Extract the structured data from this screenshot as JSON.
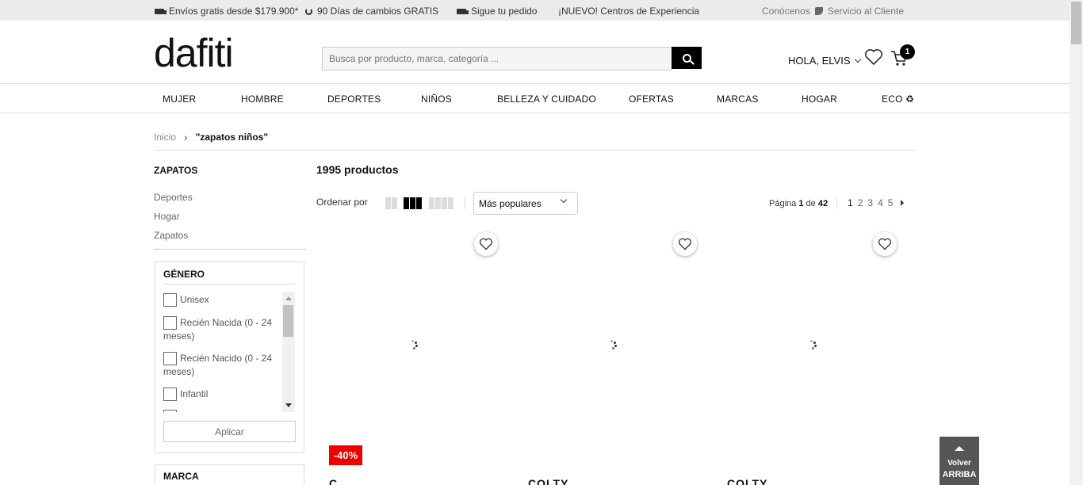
{
  "topbar": {
    "promos": [
      {
        "icon": "truck-icon",
        "text": "Envíos gratis desde $179.900*"
      },
      {
        "icon": "exchange-icon",
        "text": "90 Días de cambios GRATIS"
      },
      {
        "icon": "truck-icon",
        "text": "Sigue tu pedido"
      },
      {
        "icon": "",
        "text": "¡NUEVO! Centros de Experiencia"
      }
    ],
    "about": "Conócenos",
    "service": "Servicio al Cliente"
  },
  "header": {
    "logo": "dafiti",
    "search_placeholder": "Busca por producto, marca, categoría ...",
    "greeting": "HOLA, ELVIS",
    "cart_count": "1"
  },
  "nav": [
    "MUJER",
    "HOMBRE",
    "DEPORTES",
    "NIÑOS",
    "BELLEZA Y CUIDADO",
    "OFERTAS",
    "MARCAS",
    "HOGAR",
    "ECO ♻"
  ],
  "breadcrumb": {
    "home": "Inicio",
    "sep": "›",
    "current": "\"zapatos niños\""
  },
  "sidebar": {
    "category_title": "ZAPATOS",
    "links": [
      "Deportes",
      "Hogar",
      "Zapatos"
    ],
    "gender": {
      "title": "GÉNERO",
      "options": [
        "Unisex",
        "Recién Nacida (0 - 24 meses)",
        "Recién Nacido (0 - 24 meses)",
        "Infantil"
      ],
      "apply": "Aplicar"
    },
    "brand_title": "MARCA"
  },
  "results": {
    "count": "1995 productos",
    "order_label": "Ordenar por",
    "sort_value": "Más populares",
    "page_label": "Página",
    "page_current": "1",
    "page_of": "de",
    "page_total": "42",
    "pages": [
      "1",
      "2",
      "3",
      "4",
      "5"
    ]
  },
  "products": [
    {
      "discount": "-40%",
      "brand": "C"
    },
    {
      "discount": "",
      "brand": "COLTY"
    },
    {
      "discount": "",
      "brand": "COLTY"
    }
  ],
  "back_to_top": {
    "line1": "Volver",
    "line2": "ARRIBA"
  },
  "colors": {
    "discount": "#ee0000",
    "topbar": "#ebebeb",
    "dark": "#000000"
  }
}
